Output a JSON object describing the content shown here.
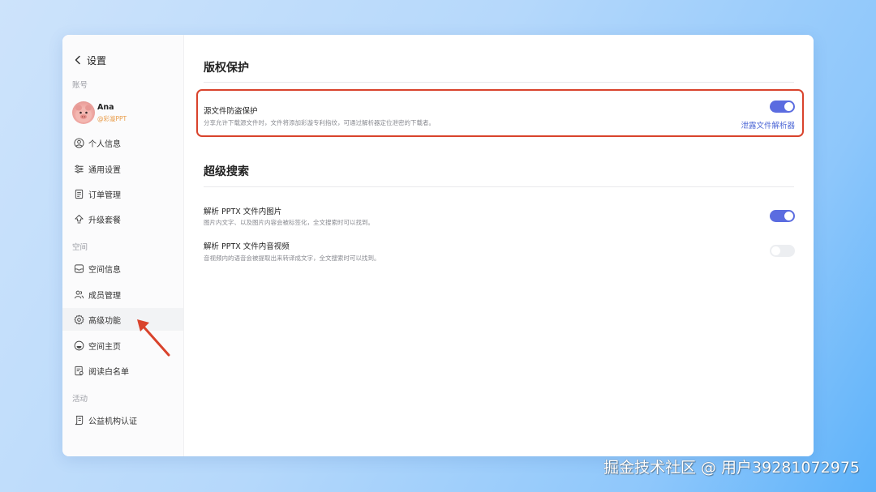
{
  "sidebar": {
    "back_title": "设置",
    "sections": {
      "account": "账号",
      "space": "空间",
      "activity": "活动"
    },
    "user": {
      "name": "Ana",
      "handle": "@彩漩PPT"
    },
    "items": [
      {
        "label": "个人信息",
        "icon": "user-circle-icon"
      },
      {
        "label": "通用设置",
        "icon": "sliders-icon"
      },
      {
        "label": "订单管理",
        "icon": "order-list-icon"
      },
      {
        "label": "升级套餐",
        "icon": "upgrade-icon"
      },
      {
        "label": "空间信息",
        "icon": "inbox-icon"
      },
      {
        "label": "成员管理",
        "icon": "members-icon"
      },
      {
        "label": "高级功能",
        "icon": "gear-icon"
      },
      {
        "label": "空间主页",
        "icon": "home-face-icon"
      },
      {
        "label": "阅读白名单",
        "icon": "whitelist-icon"
      },
      {
        "label": "公益机构认证",
        "icon": "certificate-icon"
      }
    ]
  },
  "main": {
    "copyright": {
      "title": "版权保护",
      "setting_title": "源文件防盗保护",
      "setting_desc": "分享允许下载源文件时，文件将添加彩漩专利指纹，可通过解析器定位泄密的下载者。",
      "enabled": true,
      "link": "泄露文件解析器"
    },
    "super_search": {
      "title": "超级搜索",
      "settings": [
        {
          "title": "解析 PPTX 文件内图片",
          "desc": "图片内文字、以及图片内容会被标签化，全文搜索时可以找到。",
          "enabled": true
        },
        {
          "title": "解析 PPTX 文件内音视频",
          "desc": "音视频内的语音会被提取出来转译成文字，全文搜索时可以找到。",
          "enabled": false
        }
      ]
    }
  },
  "colors": {
    "accent": "#5b6ce0",
    "link": "#4d67d6",
    "highlight": "#d9432c",
    "handle": "#e89a46"
  },
  "watermark": "掘金技术社区 @ 用户39281072975"
}
